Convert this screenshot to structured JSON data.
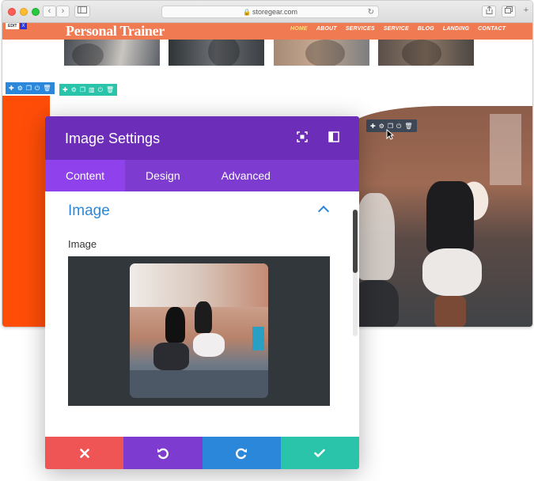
{
  "browser": {
    "url": "storegear.com",
    "reload_icon": "reload-icon",
    "share_icon": "share-icon",
    "tabs_icon": "tabs-icon",
    "new_tab_icon": "plus-icon"
  },
  "site": {
    "edit_badge": "EDIT",
    "edit_close": "X",
    "logo": "Personal Trainer",
    "menu": [
      "HOME",
      "ABOUT",
      "SERVICES",
      "SERVICE",
      "BLOG",
      "LANDING",
      "CONTACT"
    ],
    "header_color": "#f07a52",
    "accent_orange": "#ff4d08"
  },
  "modal": {
    "title": "Image Settings",
    "tabs": [
      "Content",
      "Design",
      "Advanced"
    ],
    "active_tab": "Content",
    "section_title": "Image",
    "field_label": "Image",
    "colors": {
      "header": "#6c2eb9",
      "tabs": "#7d3bcf",
      "active_tab": "#8f42ec",
      "section_title": "#2b87da"
    },
    "footer": {
      "cancel_icon": "close-icon",
      "undo_icon": "undo-icon",
      "redo_icon": "redo-icon",
      "save_icon": "check-icon",
      "colors": [
        "#ef5555",
        "#7d3bcf",
        "#2b87da",
        "#29c4a9"
      ]
    }
  }
}
